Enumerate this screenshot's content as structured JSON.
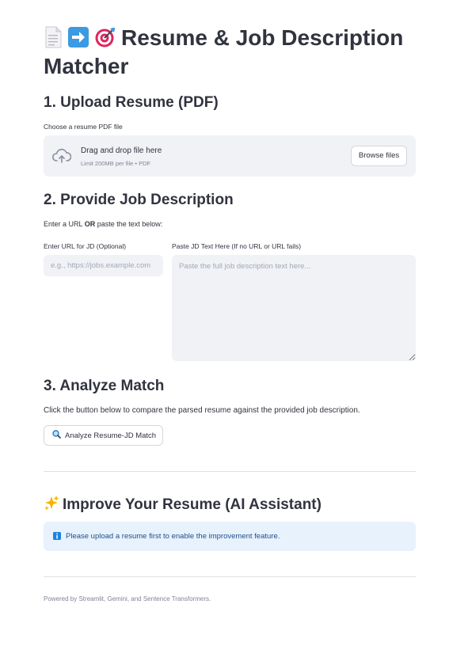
{
  "header": {
    "icons": [
      "page-icon",
      "right-arrow-icon",
      "target-icon"
    ],
    "title": "Resume & Job Description Matcher"
  },
  "upload": {
    "heading": "1. Upload Resume (PDF)",
    "label": "Choose a resume PDF file",
    "drag_text": "Drag and drop file here",
    "limit_text": "Limit 200MB per file • PDF",
    "browse_label": "Browse files"
  },
  "job": {
    "heading": "2. Provide Job Description",
    "instruction_prefix": "Enter a URL ",
    "instruction_bold": "OR",
    "instruction_suffix": " paste the text below:",
    "url_label": "Enter URL for JD (Optional)",
    "url_placeholder": "e.g., https://jobs.example.com",
    "url_value": "",
    "text_label": "Paste JD Text Here (If no URL or URL fails)",
    "text_placeholder": "Paste the full job description text here...",
    "text_value": ""
  },
  "analyze": {
    "heading": "3. Analyze Match",
    "description": "Click the button below to compare the parsed resume against the provided job description.",
    "button_label": "Analyze Resume-JD Match"
  },
  "improve": {
    "icon": "sparkles-icon",
    "heading": "Improve Your Resume (AI Assistant)",
    "info_icon": "info-icon",
    "info_text": "Please upload a resume first to enable the improvement feature."
  },
  "footer": {
    "text": "Powered by Streamlit, Gemini, and Sentence Transformers."
  },
  "colors": {
    "text": "#31333f",
    "muted": "#808495",
    "widget_bg": "#f0f2f6",
    "info_bg": "#e8f2fc",
    "info_text": "#1e4f8a",
    "arrow_blue": "#3b9ae1",
    "target_red": "#e0245e"
  }
}
